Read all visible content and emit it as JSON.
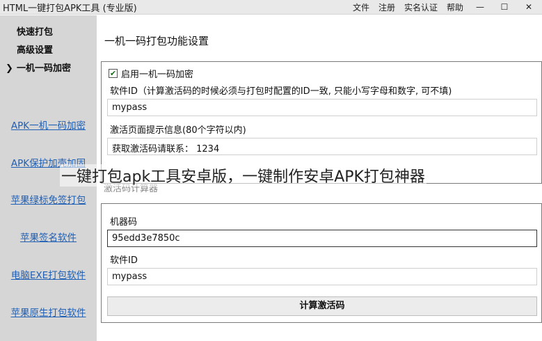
{
  "window": {
    "title": "HTML一键打包APK工具 (专业版)",
    "menu": [
      "文件",
      "注册",
      "实名认证",
      "帮助"
    ],
    "controls": [
      "—",
      "☐",
      "✕"
    ]
  },
  "sidebar": {
    "nav": [
      {
        "label": "快速打包",
        "active": false
      },
      {
        "label": "高级设置",
        "active": false
      },
      {
        "label": "一机一码加密",
        "active": true
      }
    ],
    "active_marker": "❯",
    "links": [
      "APK一机一码加密",
      "APK保护加壳加固",
      "苹果绿标免签打包",
      "苹果签名软件",
      "电脑EXE打包软件",
      "苹果原生打包软件"
    ]
  },
  "main": {
    "section_title": "一机一码打包功能设置",
    "enable_label": "启用一机一码加密",
    "enable_checked": true,
    "checkmark": "✔",
    "software_id_label": "软件ID（计算激活码的时候必须与打包时配置的ID一致, 只能小写字母和数字, 可不填)",
    "software_id_value": "mypass",
    "tip_label": "激活页面提示信息(80个字符以内)",
    "tip_value": "获取激活码请联系： 1234",
    "calculator_label": "激活码计算器",
    "machine_code_label": "机器码",
    "machine_code_value": "95edd3e7850c",
    "calc_software_id_label": "软件ID",
    "calc_software_id_value": "mypass",
    "calc_button": "计算激活码"
  },
  "overlay_caption": "一键打包apk工具安卓版，一键制作安卓APK打包神器"
}
